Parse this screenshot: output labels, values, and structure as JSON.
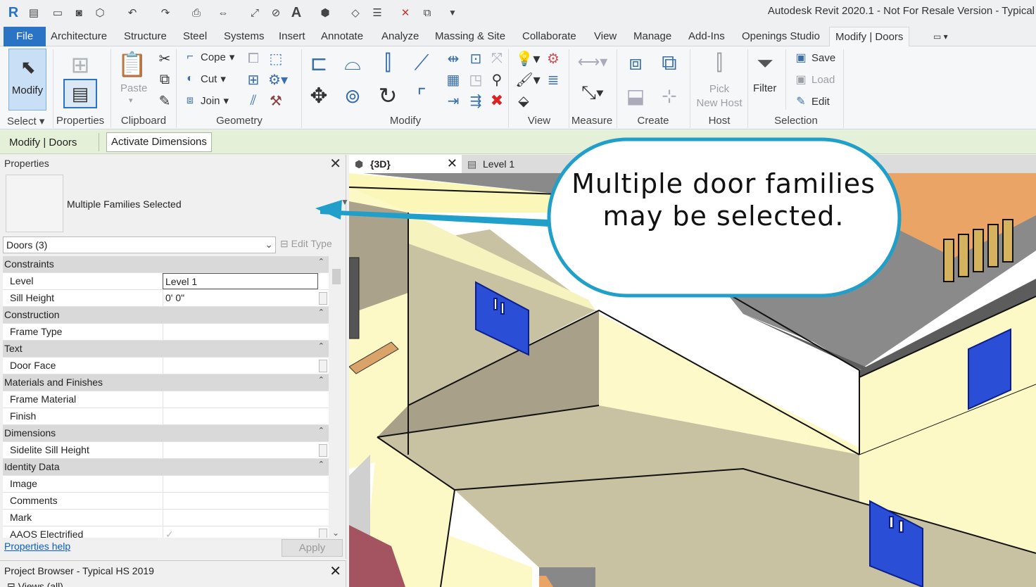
{
  "title_bar": {
    "app_title": "Autodesk Revit 2020.1 - Not For Resale Version - Typical"
  },
  "tabs": {
    "file": "File",
    "items": [
      "Architecture",
      "Structure",
      "Steel",
      "Systems",
      "Insert",
      "Annotate",
      "Analyze",
      "Massing & Site",
      "Collaborate",
      "View",
      "Manage",
      "Add-Ins",
      "Openings Studio",
      "Modify | Doors"
    ]
  },
  "ribbon": {
    "modify": "Modify",
    "paste": "Paste",
    "geometry_buttons": {
      "cope": "Cope",
      "cut": "Cut",
      "join": "Join"
    },
    "pick_new_host": [
      "Pick",
      "New Host"
    ],
    "filter": "Filter",
    "selection_buttons": {
      "save": "Save",
      "load": "Load",
      "edit": "Edit"
    },
    "panels": {
      "select": "Select",
      "properties": "Properties",
      "clipboard": "Clipboard",
      "geometry": "Geometry",
      "modify": "Modify",
      "view": "View",
      "measure": "Measure",
      "create": "Create",
      "host": "Host",
      "selection": "Selection"
    }
  },
  "options_bar": {
    "context": "Modify | Doors",
    "activate_dimensions": "Activate Dimensions"
  },
  "properties": {
    "title": "Properties",
    "type_name": "Multiple Families Selected",
    "selector": "Doors (3)",
    "edit_type": "Edit Type",
    "rows": [
      {
        "kind": "cat",
        "name": "Constraints"
      },
      {
        "kind": "param",
        "name": "Level",
        "value": "Level 1"
      },
      {
        "kind": "param",
        "name": "Sill Height",
        "value": "0'  0\""
      },
      {
        "kind": "cat",
        "name": "Construction"
      },
      {
        "kind": "param",
        "name": "Frame Type",
        "value": ""
      },
      {
        "kind": "cat",
        "name": "Text"
      },
      {
        "kind": "param",
        "name": "Door Face",
        "value": ""
      },
      {
        "kind": "cat",
        "name": "Materials and Finishes"
      },
      {
        "kind": "param",
        "name": "Frame Material",
        "value": ""
      },
      {
        "kind": "param",
        "name": "Finish",
        "value": ""
      },
      {
        "kind": "cat",
        "name": "Dimensions"
      },
      {
        "kind": "param",
        "name": "Sidelite Sill Height",
        "value": ""
      },
      {
        "kind": "cat",
        "name": "Identity Data"
      },
      {
        "kind": "param",
        "name": "Image",
        "value": ""
      },
      {
        "kind": "param",
        "name": "Comments",
        "value": ""
      },
      {
        "kind": "param",
        "name": "Mark",
        "value": ""
      },
      {
        "kind": "param",
        "name": "AAOS Electrified",
        "value": "✓"
      }
    ],
    "help_link": "Properties help",
    "apply": "Apply"
  },
  "project_browser": {
    "title": "Project Browser - Typical HS 2019",
    "root": "Views (all)"
  },
  "view_tabs": [
    {
      "label": "{3D}",
      "active": true
    },
    {
      "label": "Level 1",
      "active": false
    }
  ],
  "callout": {
    "text": "Multiple door families may be selected."
  },
  "colors": {
    "file_tab": "#2a73c5",
    "options_bar": "#e5f0d8",
    "callout_border": "#1f9fc9",
    "door_blue": "#2a4fd6"
  }
}
